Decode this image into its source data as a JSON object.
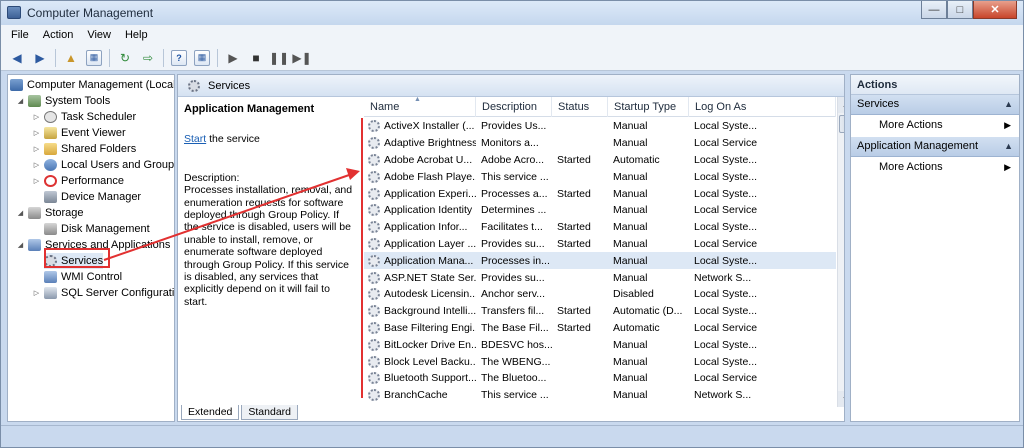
{
  "window": {
    "title": "Computer Management"
  },
  "menu": [
    "File",
    "Action",
    "View",
    "Help"
  ],
  "toolbar": {
    "icons": [
      "back-arrow-icon",
      "forward-arrow-icon",
      "up-folder-icon",
      "show-hide-tree-icon",
      "refresh-icon",
      "export-list-icon",
      "help-icon",
      "show-hide-action-pane-icon",
      "play-icon",
      "stop-icon",
      "pause-icon",
      "restart-icon"
    ]
  },
  "tree": {
    "items": [
      {
        "label": "Computer Management (Local",
        "icon": "computer-icon"
      },
      {
        "label": "System Tools",
        "icon": "tools-icon"
      },
      {
        "label": "Task Scheduler",
        "icon": "clock-icon"
      },
      {
        "label": "Event Viewer",
        "icon": "event-log-icon"
      },
      {
        "label": "Shared Folders",
        "icon": "folder-icon"
      },
      {
        "label": "Local Users and Groups",
        "icon": "users-icon"
      },
      {
        "label": "Performance",
        "icon": "performance-icon"
      },
      {
        "label": "Device Manager",
        "icon": "device-icon"
      },
      {
        "label": "Storage",
        "icon": "storage-icon"
      },
      {
        "label": "Disk Management",
        "icon": "disk-icon"
      },
      {
        "label": "Services and Applications",
        "icon": "services-apps-icon"
      },
      {
        "label": "Services",
        "icon": "gear-icon"
      },
      {
        "label": "WMI Control",
        "icon": "wmi-icon"
      },
      {
        "label": "SQL Server Configuratio",
        "icon": "sql-icon"
      }
    ]
  },
  "middle": {
    "header": "Services",
    "detail": {
      "title": "Application Management",
      "start_link": "Start",
      "start_suffix": " the service",
      "desc_label": "Description:",
      "desc_text": "Processes installation, removal, and enumeration requests for software deployed through Group Policy. If the service is disabled, users will be unable to install, remove, or enumerate software deployed through Group Policy. If this service is disabled, any services that explicitly depend on it will fail to start."
    },
    "columns": [
      "Name",
      "Description",
      "Status",
      "Startup Type",
      "Log On As"
    ],
    "rows": [
      [
        "ActiveX Installer (...",
        "Provides Us...",
        "",
        "Manual",
        "Local Syste..."
      ],
      [
        "Adaptive Brightness",
        "Monitors a...",
        "",
        "Manual",
        "Local Service"
      ],
      [
        "Adobe Acrobat U...",
        "Adobe Acro...",
        "Started",
        "Automatic",
        "Local Syste..."
      ],
      [
        "Adobe Flash Playe...",
        "This service ...",
        "",
        "Manual",
        "Local Syste..."
      ],
      [
        "Application Experi...",
        "Processes a...",
        "Started",
        "Manual",
        "Local Syste..."
      ],
      [
        "Application Identity",
        "Determines ...",
        "",
        "Manual",
        "Local Service"
      ],
      [
        "Application Infor...",
        "Facilitates t...",
        "Started",
        "Manual",
        "Local Syste..."
      ],
      [
        "Application Layer ...",
        "Provides su...",
        "Started",
        "Manual",
        "Local Service"
      ],
      [
        "Application Mana...",
        "Processes in...",
        "",
        "Manual",
        "Local Syste..."
      ],
      [
        "ASP.NET State Ser...",
        "Provides su...",
        "",
        "Manual",
        "Network S..."
      ],
      [
        "Autodesk Licensin...",
        "Anchor serv...",
        "",
        "Disabled",
        "Local Syste..."
      ],
      [
        "Background Intelli...",
        "Transfers fil...",
        "Started",
        "Automatic (D...",
        "Local Syste..."
      ],
      [
        "Base Filtering Engi...",
        "The Base Fil...",
        "Started",
        "Automatic",
        "Local Service"
      ],
      [
        "BitLocker Drive En...",
        "BDESVC hos...",
        "",
        "Manual",
        "Local Syste..."
      ],
      [
        "Block Level Backu...",
        "The WBENG...",
        "",
        "Manual",
        "Local Syste..."
      ],
      [
        "Bluetooth Support...",
        "The Bluetoo...",
        "",
        "Manual",
        "Local Service"
      ],
      [
        "BranchCache",
        "This service ...",
        "",
        "Manual",
        "Network S..."
      ]
    ],
    "selected_row": 8,
    "tabs": [
      "Extended",
      "Standard"
    ]
  },
  "actions": {
    "title": "Actions",
    "sections": [
      {
        "label": "Services",
        "item": "More Actions"
      },
      {
        "label": "Application Management",
        "item": "More Actions"
      }
    ]
  },
  "colors": {
    "annotation_red": "#e23131",
    "selection": "#dde8f5"
  }
}
